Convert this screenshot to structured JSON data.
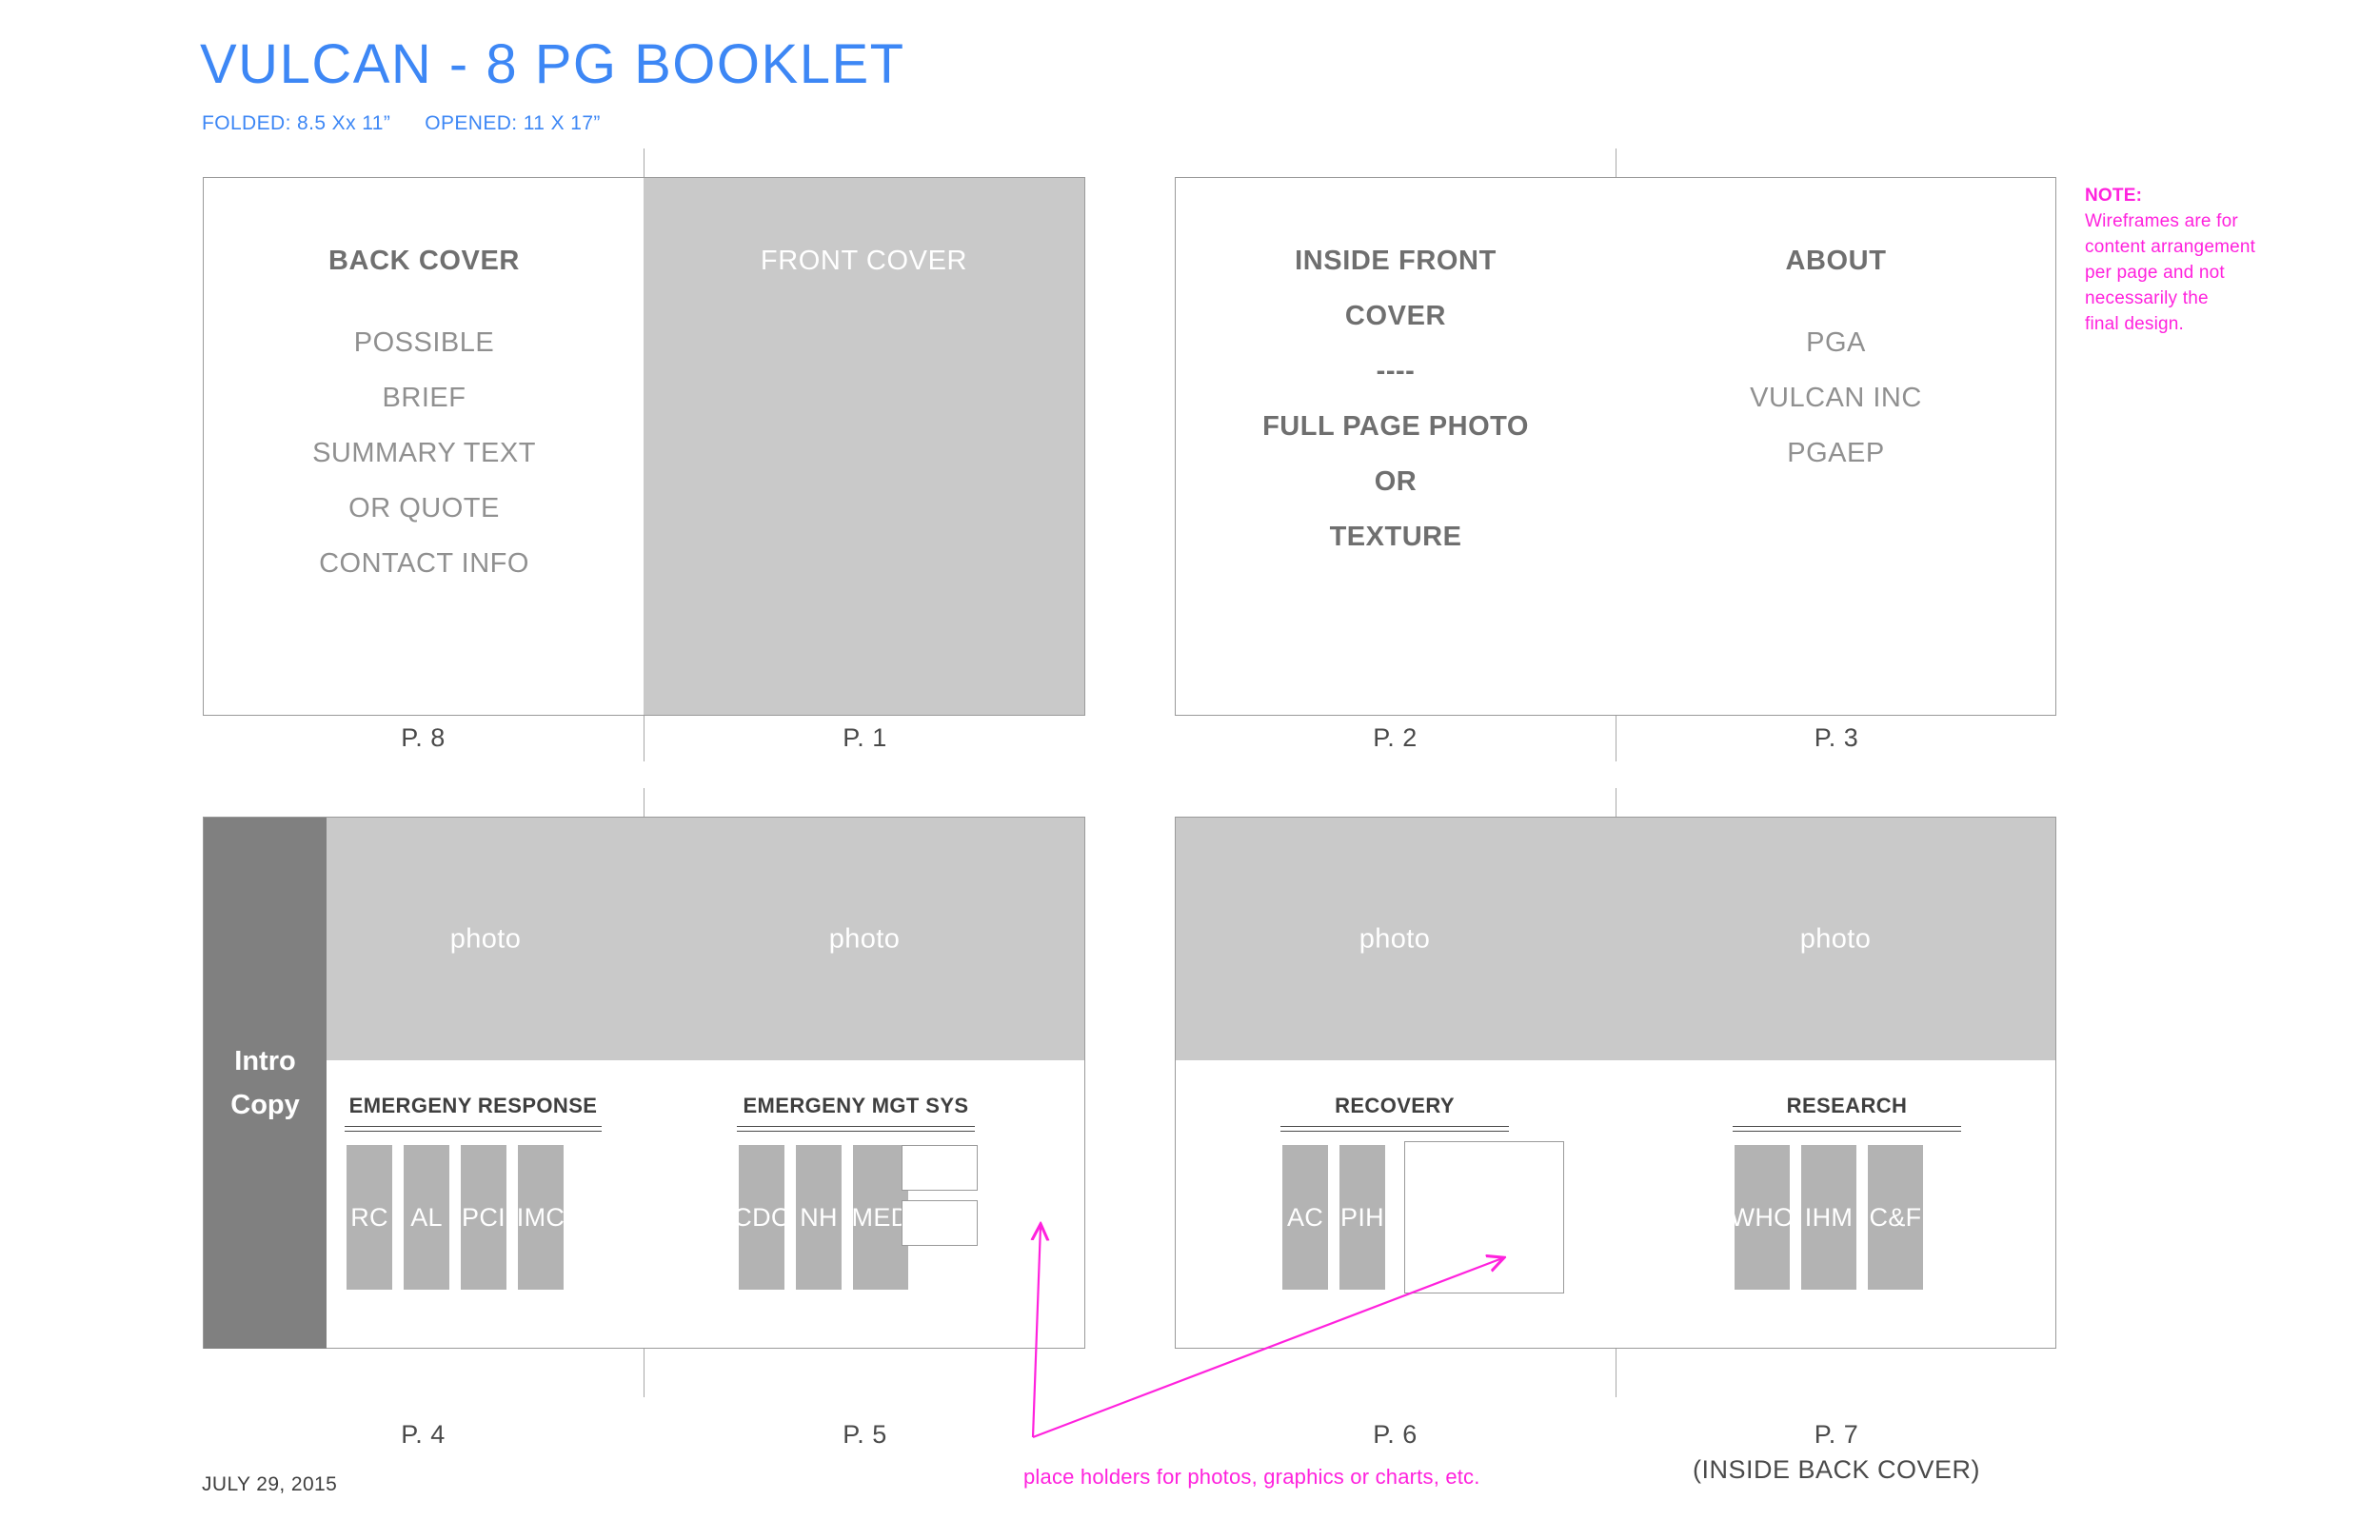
{
  "header": {
    "title": "VULCAN - 8 PG BOOKLET",
    "subtitle_folded": "FOLDED: 8.5 Xx 11”",
    "subtitle_opened": "OPENED: 11 X 17”"
  },
  "note": {
    "heading": "NOTE:",
    "line1": "Wireframes are for",
    "line2": "content arrangement",
    "line3": "per page and not",
    "line4": "necessarily the",
    "line5": "final design.",
    "color": "#ff22dd"
  },
  "colors": {
    "accent_blue": "#3d87f5",
    "magenta": "#ff22dd",
    "panel_fill": "#c9c9c9",
    "intro_fill": "#808080",
    "chip_fill": "#b3b3b3",
    "frame_stroke": "#9a9a9a"
  },
  "spreads": {
    "top_left": {
      "back_cover": {
        "heading": "BACK COVER",
        "lines": [
          "POSSIBLE",
          "BRIEF",
          "SUMMARY TEXT",
          "OR QUOTE",
          "CONTACT INFO"
        ],
        "page_label": "P. 8"
      },
      "front_cover": {
        "heading": "FRONT COVER",
        "page_label": "P. 1"
      }
    },
    "top_right": {
      "inside_front_cover": {
        "heading_line1": "INSIDE FRONT",
        "heading_line2": "COVER",
        "lines": [
          "----",
          "FULL PAGE PHOTO",
          "OR",
          "TEXTURE"
        ],
        "page_label": "P. 2"
      },
      "about": {
        "heading": "ABOUT",
        "lines": [
          "PGA",
          "VULCAN INC",
          "PGAEP"
        ],
        "page_label": "P. 3"
      }
    },
    "bottom_left": {
      "intro_copy": "Intro\nCopy",
      "intro_line1": "Intro",
      "intro_line2": "Copy",
      "photo_left_label": "photo",
      "photo_right_label": "photo",
      "page_4": {
        "section_title": "EMERGENY RESPONSE",
        "chips": [
          "RC",
          "AL",
          "PCI",
          "IMC"
        ],
        "page_label": "P. 4"
      },
      "page_5": {
        "section_title": "EMERGENY MGT SYS",
        "chips": [
          "CDC",
          "NH",
          "MED"
        ],
        "placeholders": 2,
        "page_label": "P. 5"
      }
    },
    "bottom_right": {
      "photo_left_label": "photo",
      "photo_right_label": "photo",
      "page_6": {
        "section_title": "RECOVERY",
        "chips": [
          "AC",
          "PIH"
        ],
        "placeholders": 1,
        "page_label": "P. 6"
      },
      "page_7": {
        "section_title": "RESEARCH",
        "chips": [
          "WHO",
          "IHM",
          "C&F"
        ],
        "page_label": "P. 7",
        "page_sublabel": "(INSIDE BACK COVER)"
      }
    }
  },
  "footer": {
    "date": "JULY 29, 2015",
    "callout_caption": "place holders for photos, graphics or charts, etc."
  }
}
